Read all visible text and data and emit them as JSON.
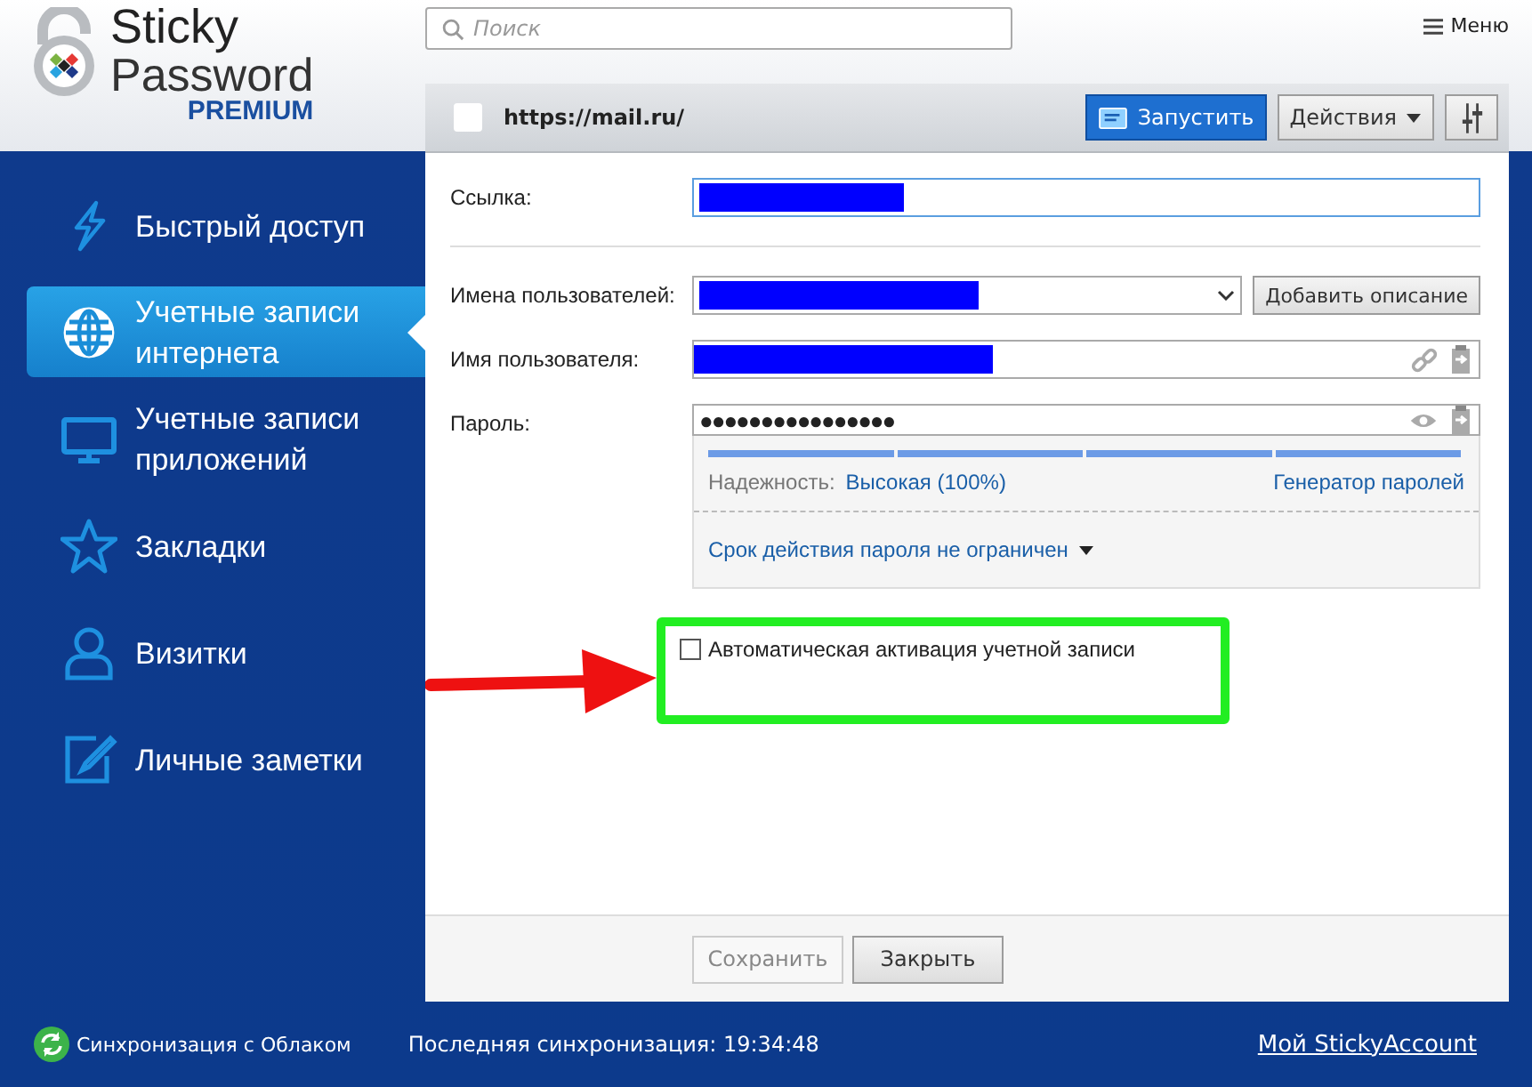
{
  "logo": {
    "line1": "Sticky",
    "line2": "Password",
    "edition": "PREMIUM"
  },
  "search": {
    "placeholder": "Поиск"
  },
  "menu": {
    "label": "Меню"
  },
  "entry": {
    "title": "https://mail.ru/",
    "launch": "Запустить",
    "actions": "Действия"
  },
  "nav": [
    {
      "label": "Быстрый доступ",
      "selected": false
    },
    {
      "label": "Учетные записи интернета",
      "selected": true
    },
    {
      "label": "Учетные записи приложений",
      "selected": false
    },
    {
      "label": "Закладки",
      "selected": false
    },
    {
      "label": "Визитки",
      "selected": false
    },
    {
      "label": "Личные заметки",
      "selected": false
    }
  ],
  "form": {
    "link_label": "Ссылка:",
    "usernames_label": "Имена пользователей:",
    "add_description": "Добавить описание",
    "username_label": "Имя пользователя:",
    "password_label": "Пароль:",
    "password": "●●●●●●●●●●●●●●●●",
    "strength_label": "Надежность:",
    "strength_value": "Высокая (100%)",
    "strength": {
      "level": 1
    },
    "generator": "Генератор паролей",
    "expiry": "Срок действия пароля не ограничен",
    "auto_activate": {
      "label": "Автоматическая активация учетной записи",
      "checked": false
    }
  },
  "buttons": {
    "save": "Сохранить",
    "close": "Закрыть"
  },
  "footer": {
    "sync": "Синхронизация с Облаком",
    "last_sync": "Последняя синхронизация: 19:34:48",
    "account": "Мой StickyAccount"
  }
}
